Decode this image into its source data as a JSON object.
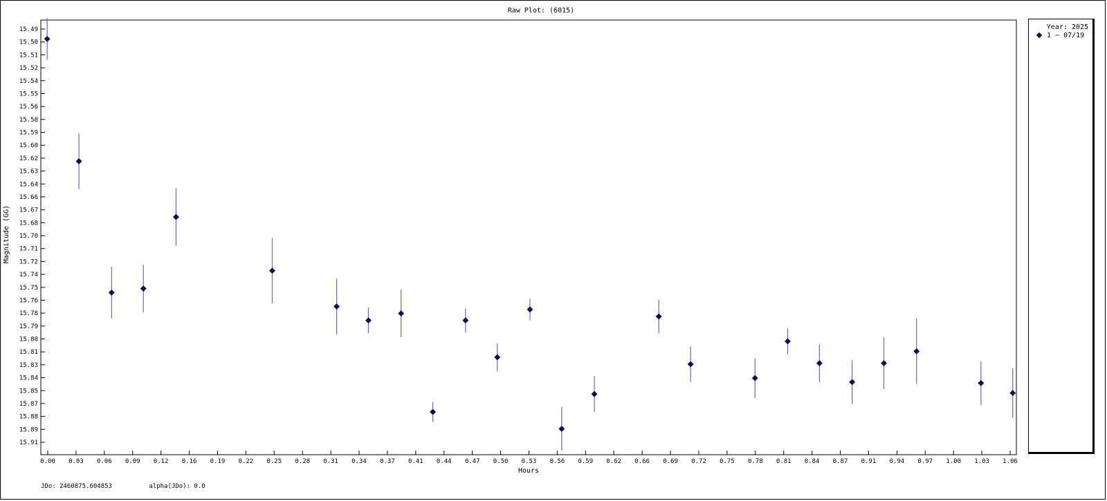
{
  "chart_data": {
    "type": "scatter",
    "title": "Raw Plot: (6015)",
    "xlabel": "Hours",
    "ylabel": "Magnitude (GG)",
    "xlim": [
      -0.007,
      1.068
    ],
    "ylim": [
      15.483,
      15.92
    ],
    "y_inverted": true,
    "grid": false,
    "legend_placement": "right",
    "x_ticks": [
      "0.00",
      "0.03",
      "0.06",
      "0.09",
      "0.12",
      "0.16",
      "0.19",
      "0.22",
      "0.25",
      "0.28",
      "0.31",
      "0.34",
      "0.37",
      "0.41",
      "0.44",
      "0.47",
      "0.50",
      "0.53",
      "0.56",
      "0.59",
      "0.62",
      "0.66",
      "0.69",
      "0.72",
      "0.75",
      "0.78",
      "0.81",
      "0.84",
      "0.87",
      "0.91",
      "0.94",
      "0.97",
      "1.00",
      "1.03",
      "1.06"
    ],
    "y_ticks": [
      "15.49",
      "15.50",
      "15.51",
      "15.52",
      "15.54",
      "15.55",
      "15.56",
      "15.58",
      "15.59",
      "15.60",
      "15.62",
      "15.63",
      "15.64",
      "15.66",
      "15.67",
      "15.68",
      "15.70",
      "15.71",
      "15.72",
      "15.74",
      "15.75",
      "15.76",
      "15.78",
      "15.79",
      "15.80",
      "15.81",
      "15.83",
      "15.84",
      "15.85",
      "15.87",
      "15.88",
      "15.89",
      "15.91"
    ],
    "series": [
      {
        "name": "1 − 07/19",
        "color": "#0b0b55",
        "errorbar_color": "#6a6ab0",
        "points": [
          {
            "x": 0.0,
            "y": 15.502,
            "err": 0.021
          },
          {
            "x": 0.035,
            "y": 15.625,
            "err": 0.028
          },
          {
            "x": 0.071,
            "y": 15.757,
            "err": 0.026
          },
          {
            "x": 0.106,
            "y": 15.753,
            "err": 0.024
          },
          {
            "x": 0.142,
            "y": 15.681,
            "err": 0.029
          },
          {
            "x": 0.248,
            "y": 15.735,
            "err": 0.033
          },
          {
            "x": 0.319,
            "y": 15.771,
            "err": 0.028
          },
          {
            "x": 0.354,
            "y": 15.785,
            "err": 0.013
          },
          {
            "x": 0.39,
            "y": 15.778,
            "err": 0.024
          },
          {
            "x": 0.425,
            "y": 15.877,
            "err": 0.01
          },
          {
            "x": 0.461,
            "y": 15.785,
            "err": 0.012
          },
          {
            "x": 0.496,
            "y": 15.822,
            "err": 0.014
          },
          {
            "x": 0.532,
            "y": 15.774,
            "err": 0.011
          },
          {
            "x": 0.567,
            "y": 15.894,
            "err": 0.022
          },
          {
            "x": 0.603,
            "y": 15.859,
            "err": 0.018
          },
          {
            "x": 0.674,
            "y": 15.781,
            "err": 0.017
          },
          {
            "x": 0.709,
            "y": 15.829,
            "err": 0.018
          },
          {
            "x": 0.78,
            "y": 15.843,
            "err": 0.02
          },
          {
            "x": 0.816,
            "y": 15.806,
            "err": 0.013
          },
          {
            "x": 0.851,
            "y": 15.828,
            "err": 0.019
          },
          {
            "x": 0.887,
            "y": 15.847,
            "err": 0.022
          },
          {
            "x": 0.922,
            "y": 15.828,
            "err": 0.026
          },
          {
            "x": 0.958,
            "y": 15.816,
            "err": 0.033
          },
          {
            "x": 1.029,
            "y": 15.848,
            "err": 0.022
          },
          {
            "x": 1.064,
            "y": 15.858,
            "err": 0.025
          }
        ]
      }
    ],
    "legend_title": "Year: 2025"
  },
  "footer": {
    "jdo": "JDo: 2460875.604853",
    "alpha": "alpha(JDo): 0.0"
  }
}
